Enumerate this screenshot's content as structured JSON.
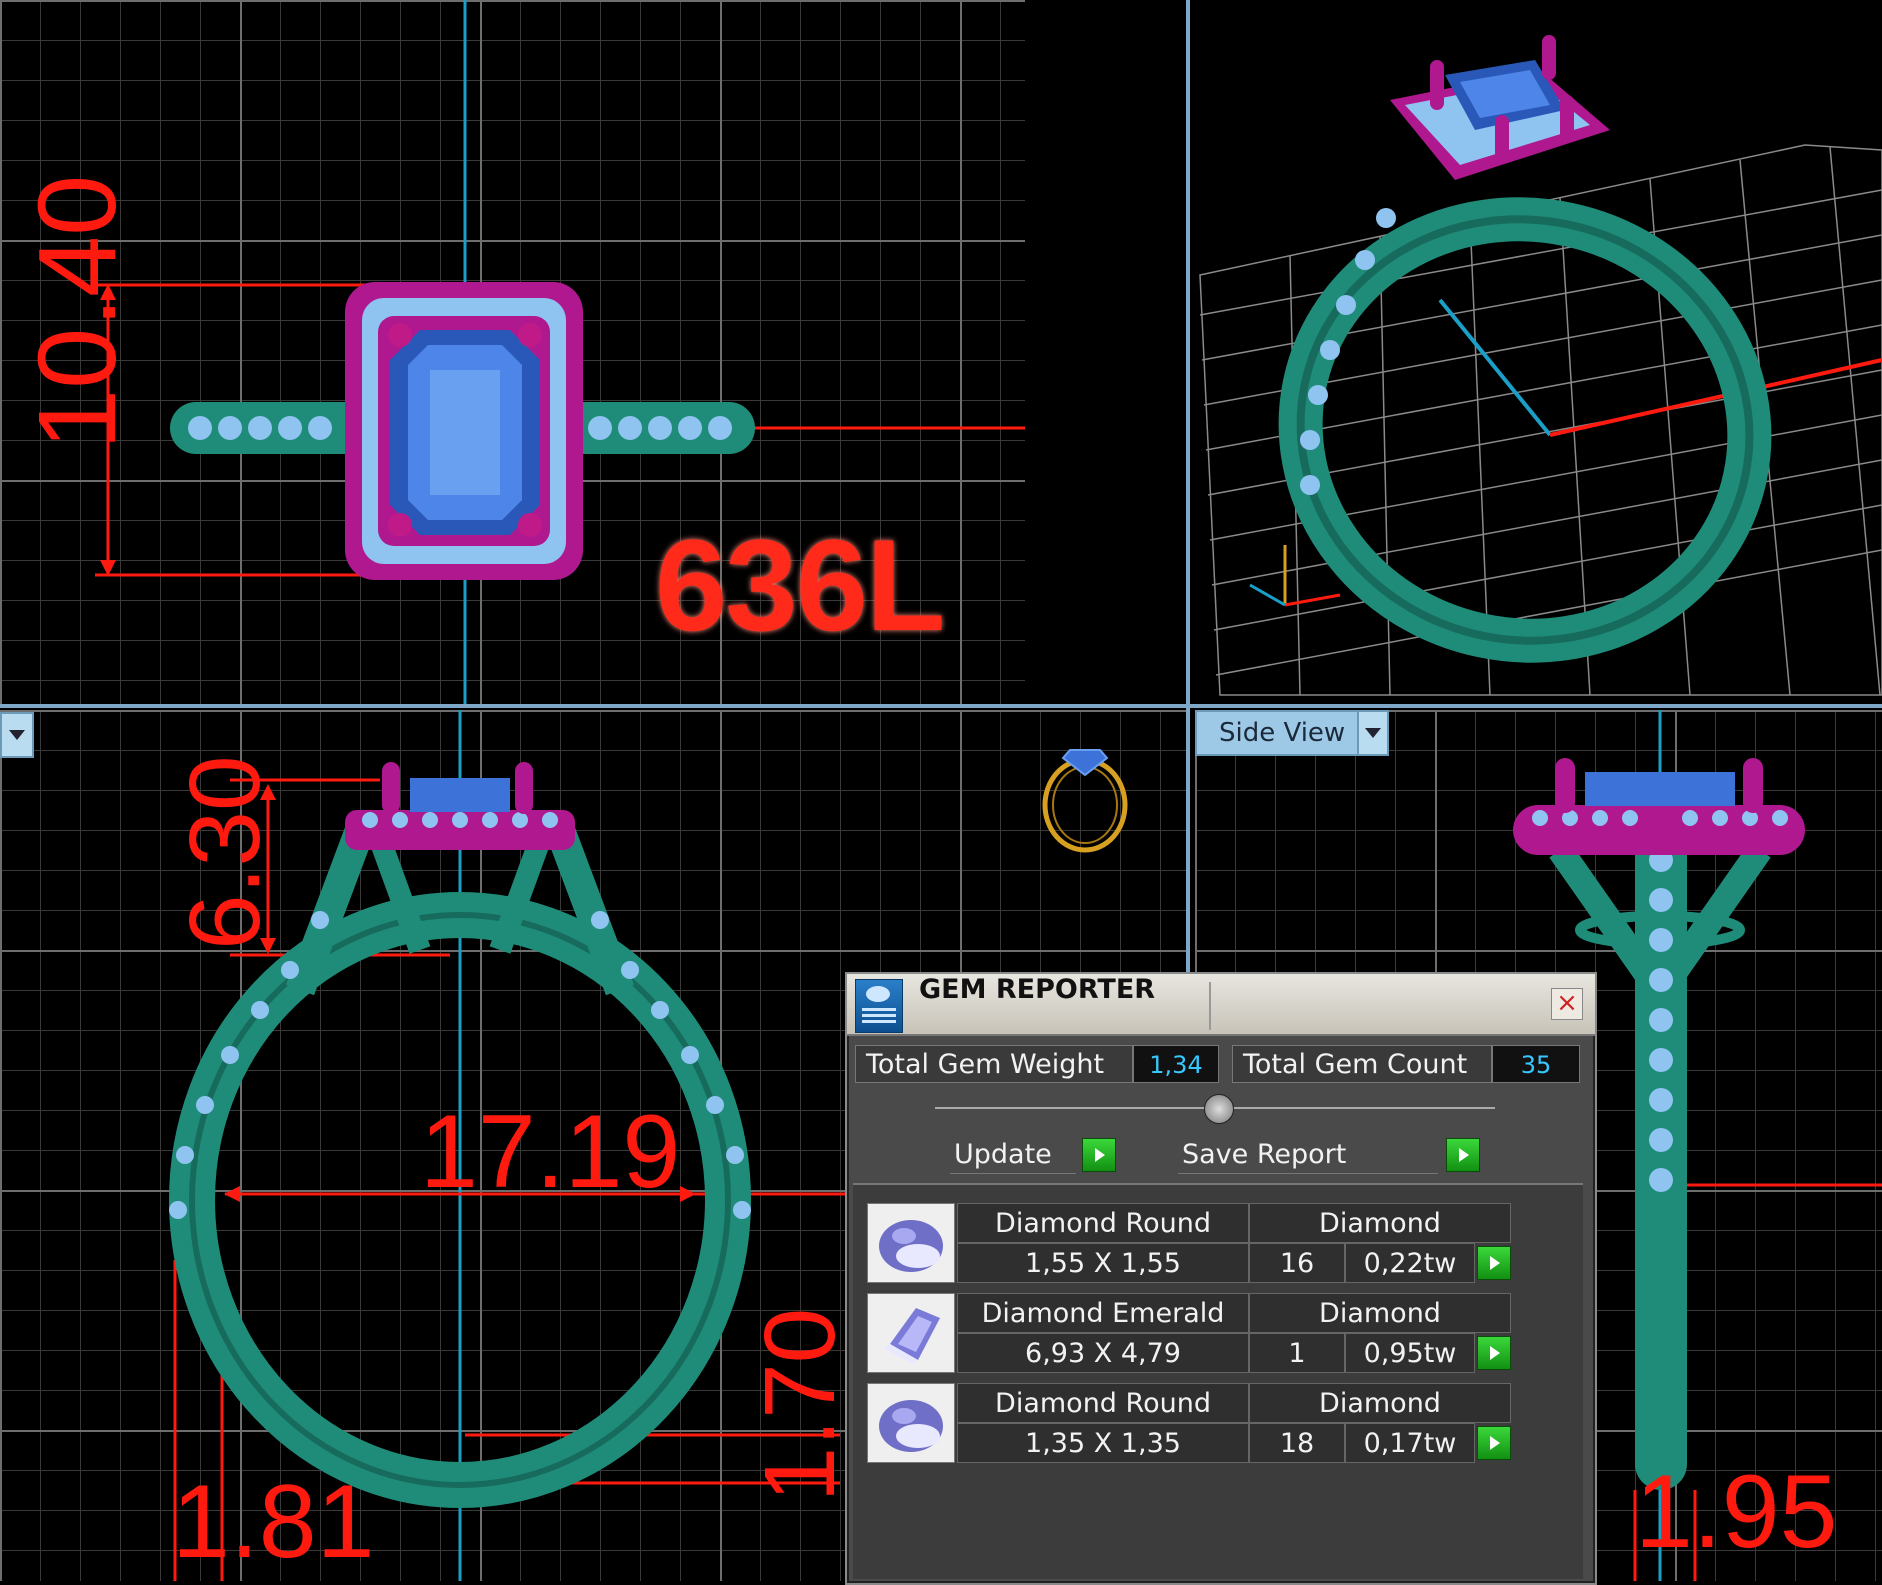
{
  "model_code": "636L",
  "views": {
    "side_view_label": "Side View"
  },
  "dimensions": {
    "top_height": "10.40",
    "front_height": "6.30",
    "inner_diameter": "17.19",
    "band_bottom": "1.70",
    "band_width_left": "1.81",
    "band_width_side": "1.95"
  },
  "gem_reporter": {
    "title": "GEM REPORTER",
    "total_weight_label": "Total Gem Weight",
    "total_weight_value": "1,34",
    "total_count_label": "Total Gem Count",
    "total_count_value": "35",
    "update_label": "Update",
    "save_label": "Save Report",
    "gems": [
      {
        "name": "Diamond Round",
        "material": "Diamond",
        "size": "1,55 X 1,55",
        "count": "16",
        "weight": "0,22tw",
        "icon": "round-gem-icon"
      },
      {
        "name": "Diamond Emerald",
        "material": "Diamond",
        "size": "6,93 X 4,79",
        "count": "1",
        "weight": "0,95tw",
        "icon": "emerald-gem-icon"
      },
      {
        "name": "Diamond Round",
        "material": "Diamond",
        "size": "1,35 X 1,35",
        "count": "18",
        "weight": "0,17tw",
        "icon": "round-gem-icon"
      }
    ]
  },
  "colors": {
    "band": "#1f8c7a",
    "setting": "#b0188f",
    "gem": "#3d73d8",
    "accent_stones": "#8fc4f0",
    "dimension": "#ff1a10"
  }
}
